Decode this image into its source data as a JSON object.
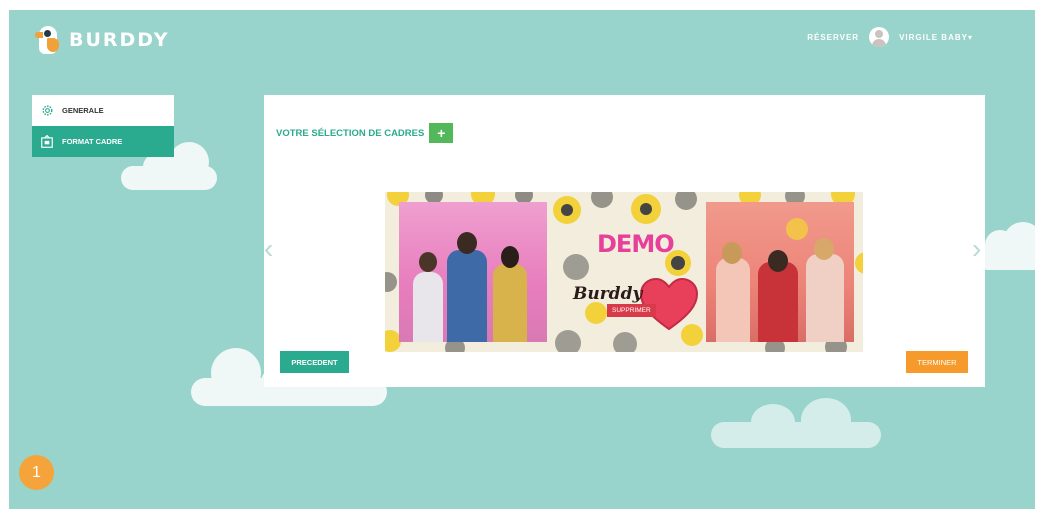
{
  "header": {
    "brand": "BURDDY",
    "reserve_link": "RÉSERVER",
    "user_name": "VIRGILE BABY",
    "user_caret": "▾"
  },
  "sidebar": {
    "items": [
      {
        "label": "GENERALE",
        "icon": "gear-icon",
        "active": false
      },
      {
        "label": "FORMAT CADRE",
        "icon": "frame-icon",
        "active": true
      }
    ]
  },
  "main": {
    "title": "VOTRE SÉLECTION DE CADRES",
    "add_label": "+",
    "prev_arrow": "‹",
    "next_arrow": "›",
    "frame": {
      "demo_text": "DEMO",
      "signature_text": "Burddy",
      "delete_label": "SUPPRIMER"
    },
    "prev_button": "PRECEDENT",
    "finish_button": "TERMINER"
  },
  "step_badge": "1",
  "colors": {
    "background": "#98d4cb",
    "primary": "#2aaa8f",
    "add": "#52b85a",
    "finish": "#f59a2b",
    "delete": "#d83a4a",
    "demo": "#e6409a",
    "badge": "#f4a43a"
  }
}
